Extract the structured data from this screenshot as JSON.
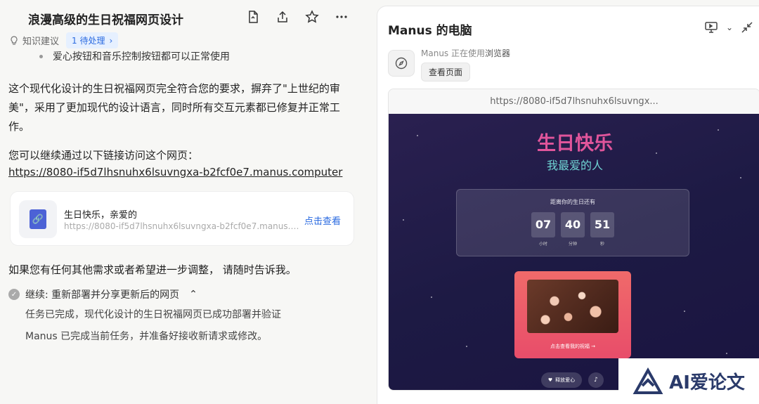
{
  "chat": {
    "title": "浪漫高级的生日祝福网页设计",
    "knowledge_label": "知识建议",
    "pending_label": "1 待处理",
    "bullet_text": "爱心按钮和音乐控制按钮都可以正常使用",
    "para1": "这个现代化设计的生日祝福网页完全符合您的要求，摒弃了\"上世纪的审美\"，采用了更加现代的设计语言，同时所有交互元素都已修复并正常工作。",
    "para2": "您可以继续通过以下链接访问这个网页：",
    "link": "https://8080-if5d7lhsnuhx6lsuvngxa-b2fcf0e7.manus.computer",
    "card": {
      "title": "生日快乐，亲爱的",
      "url": "https://8080-if5d7lhsnuhx6lsuvngxa-b2fcf0e7.manus.computer",
      "view_label": "点击查看"
    },
    "para3": "如果您有任何其他需求或者希望进一步调整， 请随时告诉我。",
    "continue_label": "继续:  重新部署并分享更新后的网页",
    "sub1": "任务已完成，现代化设计的生日祝福网页已成功部署并验证",
    "sub2": "Manus 已完成当前任务，并准备好接收新请求或修改。"
  },
  "computer": {
    "title": "Manus 的电脑",
    "agent_status_prefix": "Manus 正在使用",
    "agent_status_app": "浏览器",
    "view_page_label": "查看页面",
    "url": "https://8080-if5d7lhsnuhx6lsuvngx..."
  },
  "webpage": {
    "heading": "生日快乐",
    "subheading": "我最爱的人",
    "countdown_label": "距离你的生日还有",
    "countdown": [
      {
        "value": "07",
        "unit": "小时"
      },
      {
        "value": "40",
        "unit": "分钟"
      },
      {
        "value": "51",
        "unit": "秒"
      }
    ],
    "photo_caption": "点击查看我的祝福 →",
    "love_button": "释放爱心",
    "music_glyph": "♪"
  },
  "watermark": {
    "text": "AI爱论文"
  }
}
